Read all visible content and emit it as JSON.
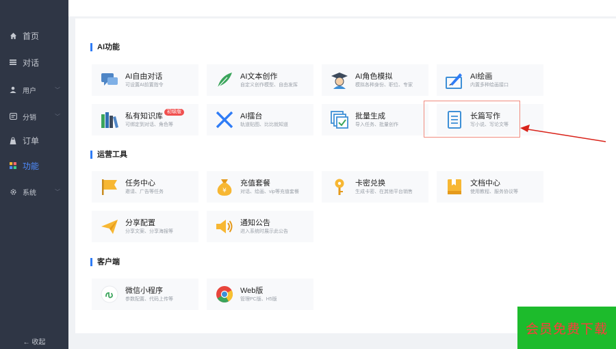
{
  "sidebar": {
    "items": [
      {
        "label": "首页",
        "icon": "home-icon"
      },
      {
        "label": "对话",
        "icon": "menu-lines-icon"
      },
      {
        "label": "用户",
        "icon": "user-icon",
        "chevron": "﹀"
      },
      {
        "label": "分销",
        "icon": "share-icon",
        "chevron": "﹀"
      },
      {
        "label": "订单",
        "icon": "bag-icon"
      },
      {
        "label": "功能",
        "icon": "grid-icon"
      },
      {
        "label": "系统",
        "icon": "gear-icon",
        "chevron": "﹀"
      }
    ],
    "collapse_label": "← 收起"
  },
  "sections": {
    "ai": {
      "title": "AI功能",
      "cards": [
        {
          "name": "AI自由对话",
          "desc": "可设置AI前置指令",
          "icon": "chat-icon"
        },
        {
          "name": "AI文本创作",
          "desc": "自定义创作模型、自由发挥",
          "icon": "feather-icon"
        },
        {
          "name": "AI角色模拟",
          "desc": "模拟各种身份、职位、专家",
          "icon": "graduate-icon"
        },
        {
          "name": "AI绘画",
          "desc": "内置多种绘画接口",
          "icon": "paint-icon"
        },
        {
          "name": "私有知识库",
          "desc": "可绑定到对话、角色等",
          "icon": "books-icon",
          "badge": "初级版"
        },
        {
          "name": "AI擂台",
          "desc": "轨道贴图、比比就知道",
          "icon": "swords-icon"
        },
        {
          "name": "批量生成",
          "desc": "导入任务、批量创作",
          "icon": "batch-icon"
        },
        {
          "name": "长篇写作",
          "desc": "写小说、写论文等",
          "icon": "document-icon"
        }
      ]
    },
    "ops": {
      "title": "运营工具",
      "cards": [
        {
          "name": "任务中心",
          "desc": "邀请、广告等任务",
          "icon": "flag-icon"
        },
        {
          "name": "充值套餐",
          "desc": "对话、绘画、vip等充值套餐",
          "icon": "money-bag-icon"
        },
        {
          "name": "卡密兑换",
          "desc": "生成卡密、在其他平台销售",
          "icon": "key-icon"
        },
        {
          "name": "文档中心",
          "desc": "使用教程、服务协议等",
          "icon": "doc-center-icon"
        },
        {
          "name": "分享配置",
          "desc": "分享文案、分享海报等",
          "icon": "paper-plane-icon"
        },
        {
          "name": "通知公告",
          "desc": "进入系统时展示此公告",
          "icon": "speaker-icon"
        }
      ]
    },
    "client": {
      "title": "客户端",
      "cards": [
        {
          "name": "微信小程序",
          "desc": "参数配置、代码上传等",
          "icon": "mini-program-icon"
        },
        {
          "name": "Web版",
          "desc": "管理PC版、H5版",
          "icon": "chrome-icon"
        }
      ]
    }
  },
  "promo": {
    "text": "会员免费下载"
  },
  "colors": {
    "accent": "#2f7cf6",
    "sidebar": "#2f3645",
    "active": "#4f8cff",
    "highlight": "#f08a7e",
    "arrow": "#d9231a",
    "promo_bg": "#1dbb2c",
    "promo_text": "#ff3b3b"
  }
}
